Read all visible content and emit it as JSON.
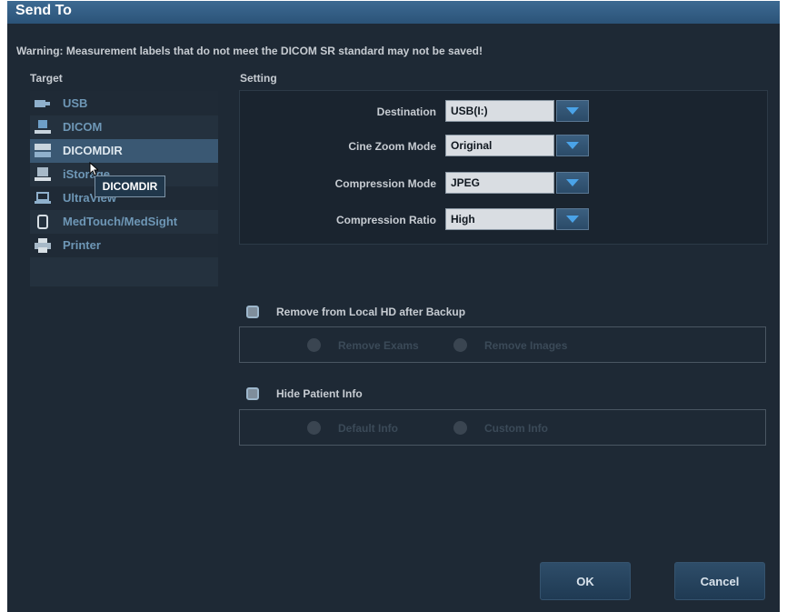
{
  "dialog": {
    "title": "Send To",
    "warning": "Warning: Measurement labels that do not meet the DICOM SR standard may not be saved!"
  },
  "target": {
    "header": "Target",
    "selected": "DICOMDIR",
    "tooltip": "DICOMDIR",
    "items": [
      {
        "label": "USB",
        "icon": "usb-icon"
      },
      {
        "label": "DICOM",
        "icon": "dicom-icon"
      },
      {
        "label": "DICOMDIR",
        "icon": "dicomdir-icon"
      },
      {
        "label": "iStorage",
        "icon": "istorage-icon"
      },
      {
        "label": "UltraView",
        "icon": "laptop-icon"
      },
      {
        "label": "MedTouch/MedSight",
        "icon": "tablet-icon"
      },
      {
        "label": "Printer",
        "icon": "printer-icon"
      }
    ]
  },
  "setting": {
    "header": "Setting",
    "rows": [
      {
        "label": "Destination",
        "value": "USB(I:)"
      },
      {
        "label": "Cine Zoom Mode",
        "value": "Original"
      },
      {
        "label": "Compression Mode",
        "value": "JPEG"
      },
      {
        "label": "Compression Ratio",
        "value": "High"
      }
    ]
  },
  "backup": {
    "checkbox_label": "Remove from Local HD after Backup",
    "checked": false,
    "options": [
      "Remove Exams",
      "Remove Images"
    ]
  },
  "patient": {
    "checkbox_label": "Hide Patient Info",
    "checked": false,
    "options": [
      "Default Info",
      "Custom Info"
    ]
  },
  "buttons": {
    "ok": "OK",
    "cancel": "Cancel"
  },
  "colors": {
    "title_bar": "#2e5a82",
    "background": "#1e2935",
    "selected_row": "#3a5873",
    "accent": "#3b8fd6"
  }
}
